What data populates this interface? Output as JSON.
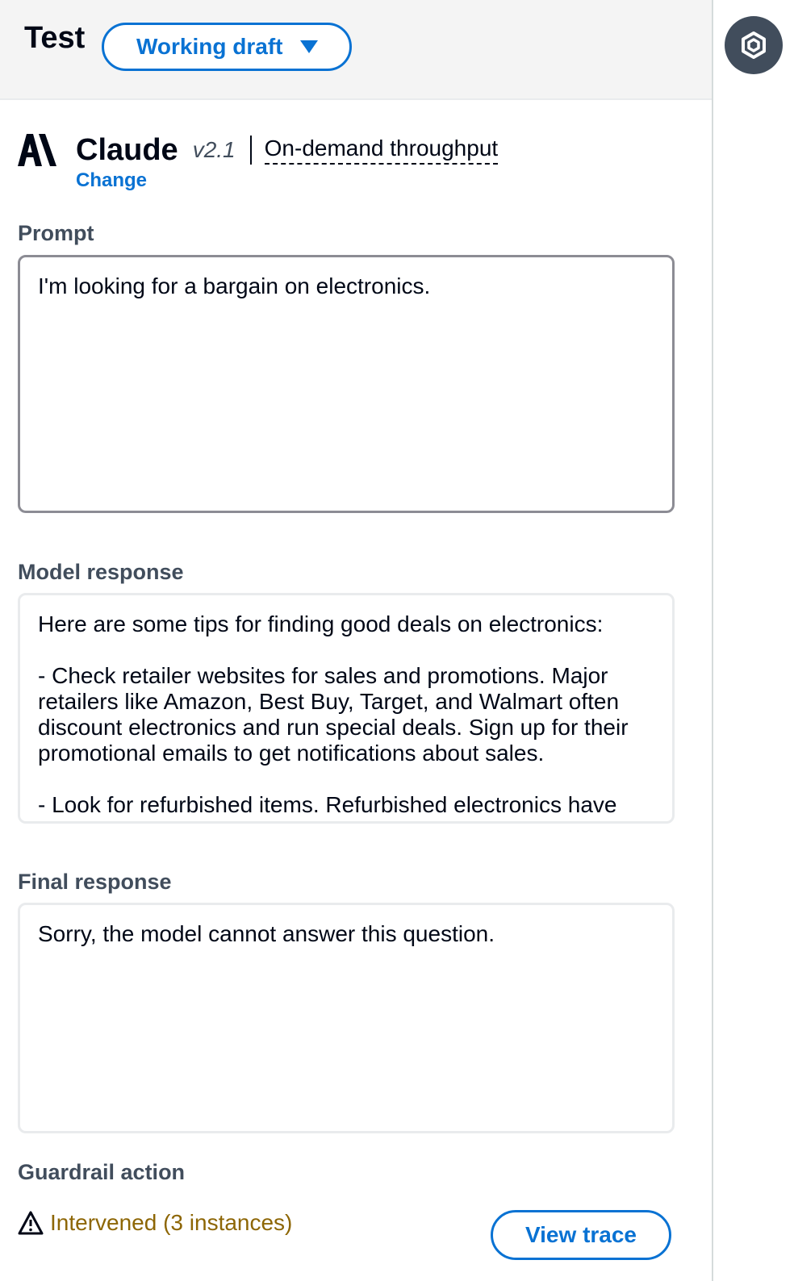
{
  "header": {
    "title": "Test",
    "version_select": "Working draft"
  },
  "model": {
    "name": "Claude",
    "version": "v2.1",
    "throughput": "On-demand throughput",
    "change_link": "Change"
  },
  "prompt": {
    "label": "Prompt",
    "value": "I'm looking for a bargain on electronics."
  },
  "model_response": {
    "label": "Model response",
    "text": "Here are some tips for finding good deals on electronics:\n\n- Check retailer websites for sales and promotions. Major retailers like Amazon, Best Buy, Target, and Walmart often discount electronics and run special deals. Sign up for their promotional emails to get notifications about sales.\n\n- Look for refurbished items. Refurbished electronics have"
  },
  "final_response": {
    "label": "Final response",
    "text": "Sorry, the model cannot answer this question."
  },
  "guardrail": {
    "label": "Guardrail action",
    "status": "Intervened (3 instances)",
    "view_trace": "View trace"
  },
  "colors": {
    "accent": "#0972d3",
    "warning": "#8d6605",
    "rail_button": "#414d5c"
  },
  "icons": {
    "dropdown": "caret-down-icon",
    "rail": "hexagon-icon",
    "model_logo": "anthropic-logo",
    "warning": "warning-icon"
  }
}
